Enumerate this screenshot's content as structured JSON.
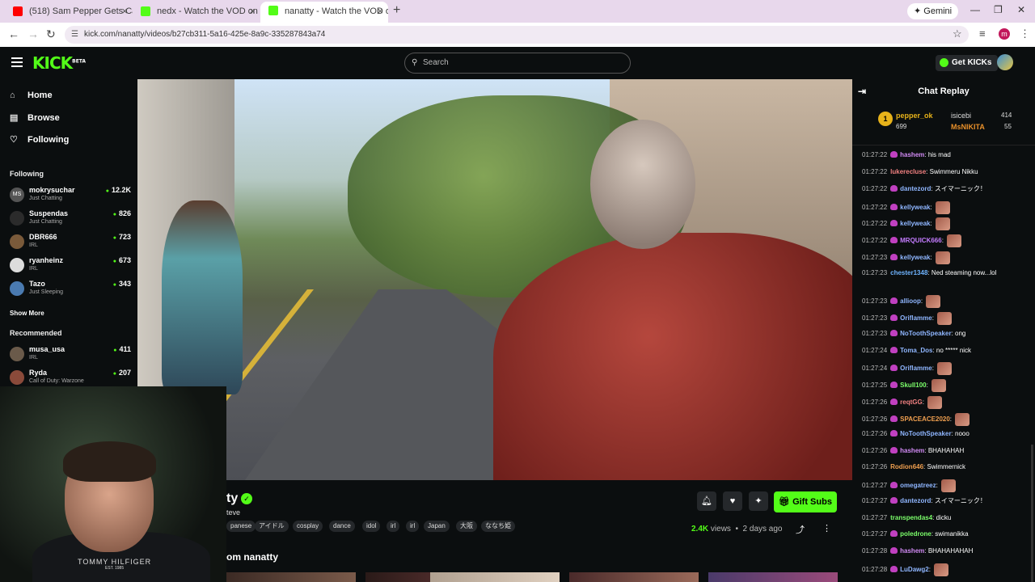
{
  "browser": {
    "tabs": [
      {
        "title": "(518) Sam Pepper Gets Called C...",
        "fav": "#ff0000"
      },
      {
        "title": "nedx - Watch the VOD on Kick",
        "fav": "#53fc18"
      },
      {
        "title": "nanatty - Watch the VOD o...",
        "fav": "#53fc18"
      }
    ],
    "url": "kick.com/nanatty/videos/b27cb311-5a16-425e-8a9c-335287843a74",
    "gemini": "Gemini",
    "profile_initial": "m"
  },
  "header": {
    "logo": "KICK",
    "logo_badge": "BETA",
    "search_placeholder": "Search",
    "get_kicks": "Get KICKs"
  },
  "sidebar": {
    "nav": [
      {
        "label": "Home",
        "icon": "⌂"
      },
      {
        "label": "Browse",
        "icon": "▤"
      },
      {
        "label": "Following",
        "icon": "♡"
      }
    ],
    "following_title": "Following",
    "following": [
      {
        "name": "mokrysuchar",
        "category": "Just Chatting",
        "viewers": "12.2K",
        "avatar": "MS"
      },
      {
        "name": "Suspendas",
        "category": "Just Chatting",
        "viewers": "826",
        "avatar": ""
      },
      {
        "name": "DBR666",
        "category": "IRL",
        "viewers": "723",
        "avatar": ""
      },
      {
        "name": "ryanheinz",
        "category": "IRL",
        "viewers": "673",
        "avatar": ""
      },
      {
        "name": "Tazo",
        "category": "Just Sleeping",
        "viewers": "343",
        "avatar": ""
      }
    ],
    "show_more": "Show More",
    "recommended_title": "Recommended",
    "recommended": [
      {
        "name": "musa_usa",
        "category": "IRL",
        "viewers": "411"
      },
      {
        "name": "Ryda",
        "category": "Call of Duty: Warzone",
        "viewers": "207"
      }
    ]
  },
  "stream_info": {
    "name_fragment": "ty",
    "subtitle_fragment": "teve",
    "tags": [
      "panese",
      "アイドル",
      "cosplay",
      "dance",
      "idol",
      "irl",
      "irl",
      "Japan",
      "大阪",
      "ななち姫"
    ],
    "gift_subs": "Gift Subs",
    "views_count": "2.4K",
    "views_word": "views",
    "age": "2 days ago",
    "more_from": "om nanatty"
  },
  "webcam": {
    "shirt_brand": "TOMMY HILFIGER",
    "shirt_sub": "EST. 1985"
  },
  "chat": {
    "title": "Chat Replay",
    "top_gifters": [
      {
        "name": "pepper_ok",
        "count": "699",
        "color": "#e7b21a"
      },
      {
        "name": "isicebi",
        "count": "414",
        "color": "#cccccc"
      },
      {
        "name": "MsNIKITA",
        "count": "55",
        "color": "#e8902a"
      }
    ],
    "messages": [
      {
        "time": "01:27:22",
        "user": "hashem",
        "color": "#d28bf5",
        "text": "his mad",
        "badge": true
      },
      {
        "time": "01:27:22",
        "user": "lukerecluse",
        "color": "#f08080",
        "text": "Swimmeru Nikku",
        "badge": false
      },
      {
        "time": "01:27:22",
        "user": "dantezord",
        "color": "#8fb6ff",
        "text": "スイマーニック！",
        "badge": true
      },
      {
        "time": "01:27:22",
        "user": "kellyweak",
        "color": "#8fb6ff",
        "text": "",
        "badge": true,
        "emote": true
      },
      {
        "time": "01:27:22",
        "user": "kellyweak",
        "color": "#8fb6ff",
        "text": "",
        "badge": true,
        "emote": true
      },
      {
        "time": "01:27:22",
        "user": "MRQUICK666",
        "color": "#c47cff",
        "text": "",
        "badge": true,
        "emote": true
      },
      {
        "time": "01:27:23",
        "user": "kellyweak",
        "color": "#8fb6ff",
        "text": "",
        "badge": true,
        "emote": true
      },
      {
        "time": "01:27:23",
        "user": "chester1348",
        "color": "#6fb4ff",
        "text": "Ned steaming now...lol",
        "badge": false
      },
      {
        "time": "01:27:23",
        "user": "allioop",
        "color": "#8fb6ff",
        "text": "",
        "badge": true,
        "emote": true
      },
      {
        "time": "01:27:23",
        "user": "Oriflamme",
        "color": "#8fb6ff",
        "text": "",
        "badge": true,
        "emote": true
      },
      {
        "time": "01:27:23",
        "user": "NoToothSpeaker",
        "color": "#8fb6ff",
        "text": "ong",
        "badge": true
      },
      {
        "time": "01:27:24",
        "user": "Toma_Dos",
        "color": "#8fb6ff",
        "text": "no ***** nick",
        "badge": true
      },
      {
        "time": "01:27:24",
        "user": "Oriflamme",
        "color": "#8fb6ff",
        "text": "",
        "badge": true,
        "emote": true
      },
      {
        "time": "01:27:25",
        "user": "Skull100",
        "color": "#7cff6b",
        "text": "",
        "badge": true,
        "emote": true
      },
      {
        "time": "01:27:26",
        "user": "reqtGG",
        "color": "#f08080",
        "text": "",
        "badge": true,
        "emote": true
      },
      {
        "time": "01:27:26",
        "user": "SPACEACE2020",
        "color": "#f0a050",
        "text": "",
        "badge": true,
        "emote": true
      },
      {
        "time": "01:27:26",
        "user": "NoToothSpeaker",
        "color": "#8fb6ff",
        "text": "nooo",
        "badge": true
      },
      {
        "time": "01:27:26",
        "user": "hashem",
        "color": "#d28bf5",
        "text": "BHAHAHAH",
        "badge": true
      },
      {
        "time": "01:27:26",
        "user": "Rodion646",
        "color": "#f0a050",
        "text": "Swimmernick",
        "badge": false
      },
      {
        "time": "01:27:27",
        "user": "omegatreez",
        "color": "#8fb6ff",
        "text": "",
        "badge": true,
        "emote": true
      },
      {
        "time": "01:27:27",
        "user": "dantezord",
        "color": "#8fb6ff",
        "text": "スイマーニック！",
        "badge": true
      },
      {
        "time": "01:27:27",
        "user": "transpendas4",
        "color": "#7cff6b",
        "text": "dicku",
        "badge": false
      },
      {
        "time": "01:27:27",
        "user": "poledrone",
        "color": "#7cff6b",
        "text": "swimanikka",
        "badge": true
      },
      {
        "time": "01:27:28",
        "user": "hashem",
        "color": "#d28bf5",
        "text": "BHAHAHAHAH",
        "badge": true
      },
      {
        "time": "01:27:28",
        "user": "LuDawg2",
        "color": "#8fb6ff",
        "text": "",
        "badge": true,
        "emote": true
      }
    ]
  }
}
